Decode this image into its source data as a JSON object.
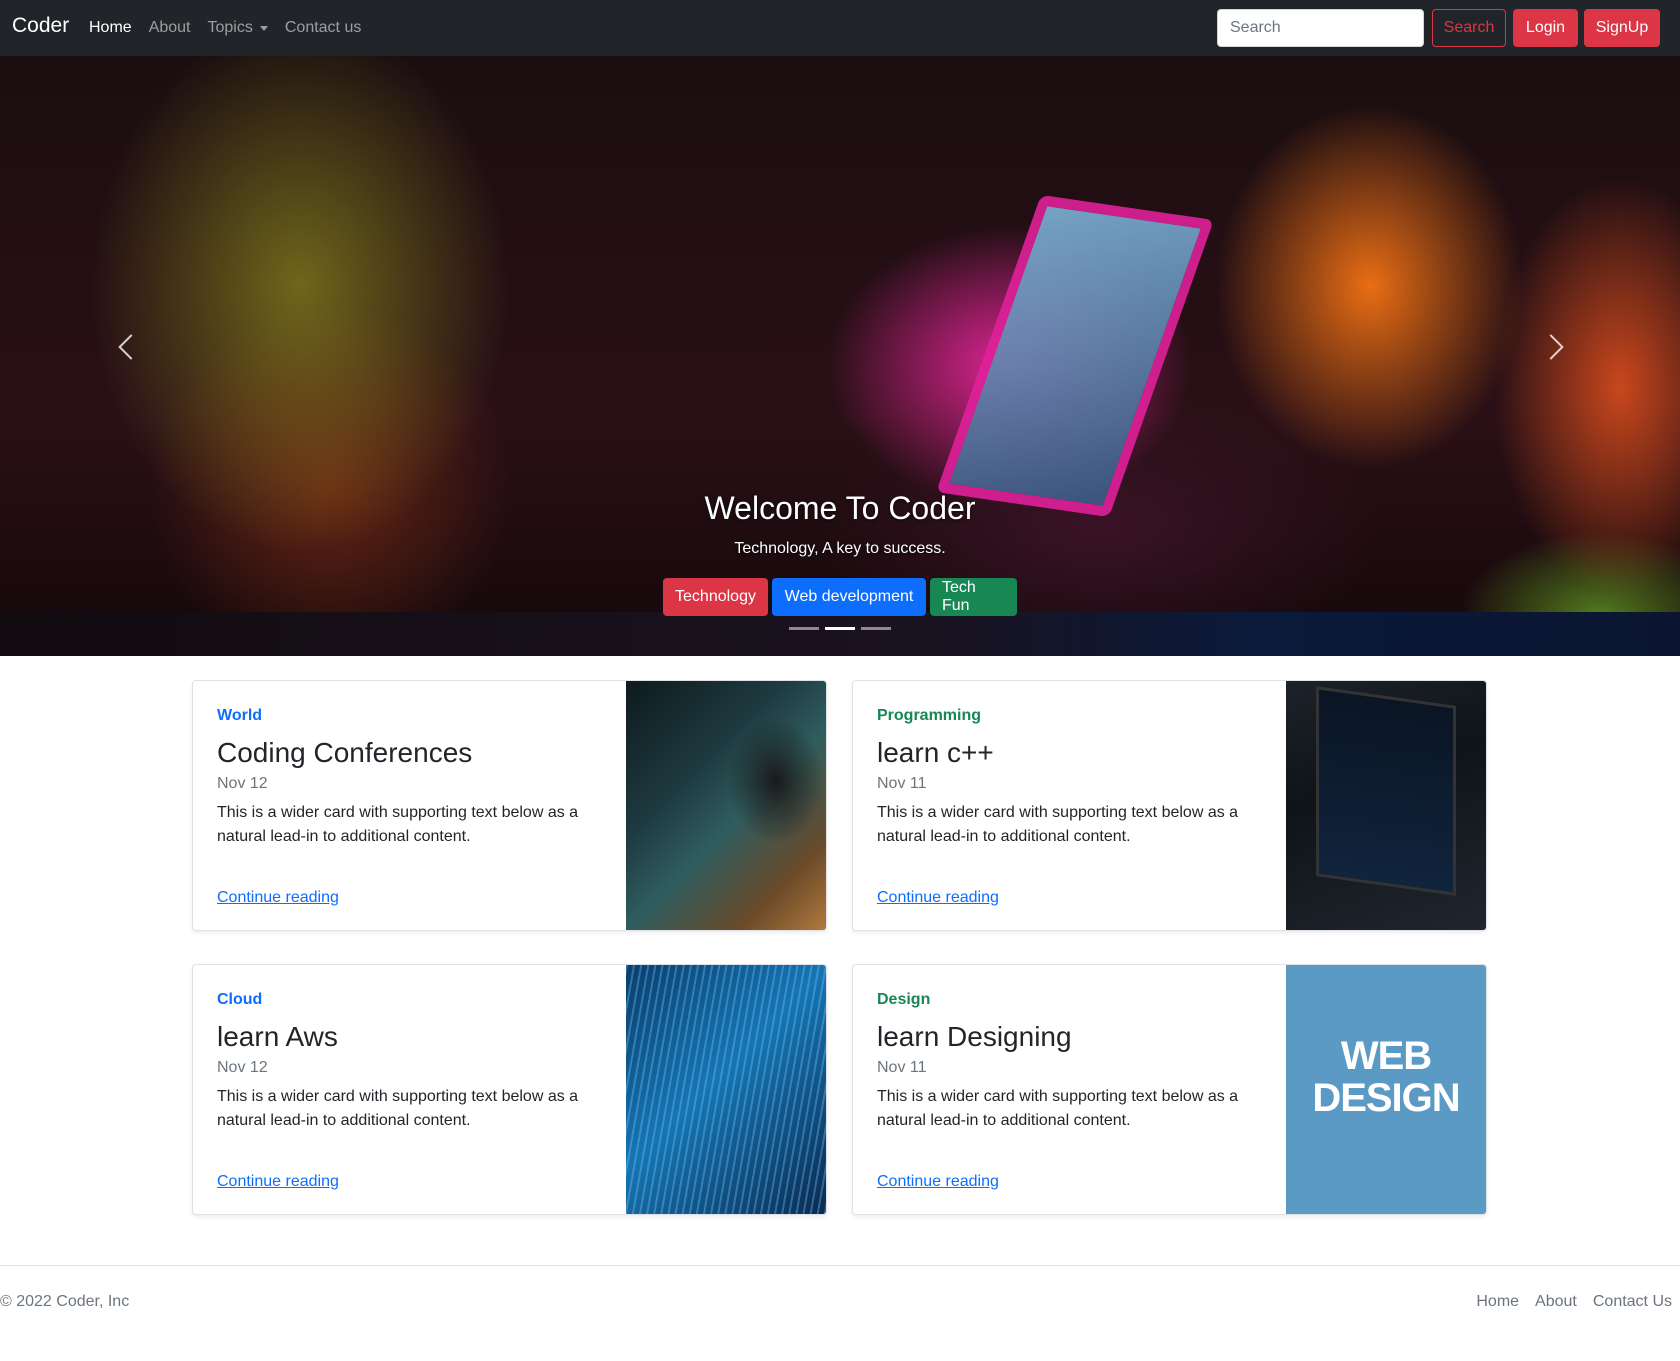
{
  "nav": {
    "brand": "Coder",
    "links": [
      "Home",
      "About",
      "Topics",
      "Contact us"
    ],
    "search_placeholder": "Search",
    "search_button": "Search",
    "login_button": "Login",
    "signup_button": "SignUp"
  },
  "hero": {
    "title": "Welcome To Coder",
    "subtitle": "Technology, A key to success.",
    "buttons": [
      "Technology",
      "Web development",
      "Tech Fun"
    ],
    "active_slide": 2,
    "slide_count": 3
  },
  "cards": [
    {
      "category": "World",
      "title": "Coding Conferences",
      "date": "Nov 12",
      "text": "This is a wider card with supporting text below as a natural lead-in to additional content.",
      "link": "Continue reading",
      "category_color": "#0d6efd"
    },
    {
      "category": "Programming",
      "title": "learn c++",
      "date": "Nov 11",
      "text": "This is a wider card with supporting text below as a natural lead-in to additional content.",
      "link": "Continue reading",
      "category_color": "#198754"
    },
    {
      "category": "Cloud",
      "title": "learn Aws",
      "date": "Nov 12",
      "text": "This is a wider card with supporting text below as a natural lead-in to additional content.",
      "link": "Continue reading",
      "category_color": "#0d6efd"
    },
    {
      "category": "Design",
      "title": "learn Designing",
      "date": "Nov 11",
      "text": "This is a wider card with supporting text below as a natural lead-in to additional content.",
      "link": "Continue reading",
      "category_color": "#198754"
    }
  ],
  "card_image_text": "WEB DESIGN",
  "footer": {
    "copyright": "© 2022 Coder, Inc",
    "links": [
      "Home",
      "About",
      "Contact Us"
    ]
  },
  "colors": {
    "navbar_bg": "#212529",
    "danger": "#dc3545",
    "primary": "#0d6efd",
    "success": "#198754"
  }
}
